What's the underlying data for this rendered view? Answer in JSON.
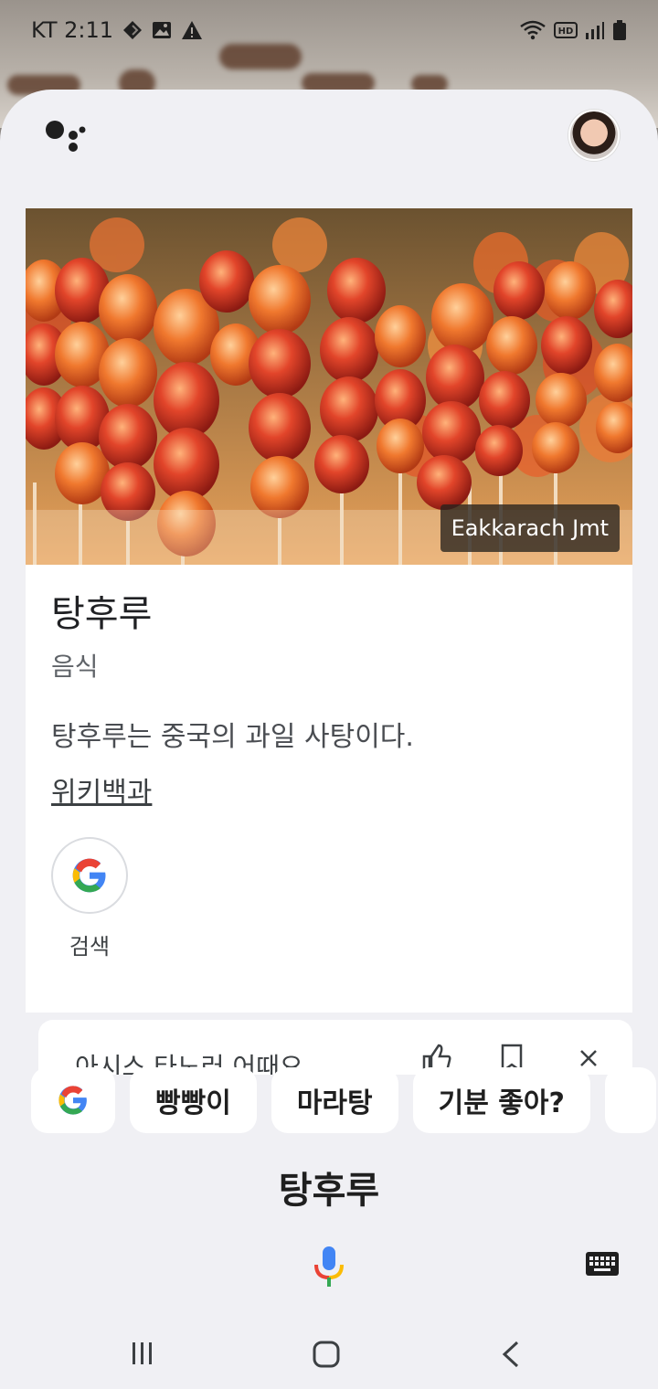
{
  "status_bar": {
    "carrier_time": "KT 2:11",
    "icons": [
      "diamond-icon",
      "image-icon",
      "warning-icon",
      "wifi-icon",
      "hd-icon",
      "signal-icon",
      "battery-icon"
    ]
  },
  "assistant": {
    "logo": "google-assistant-icon",
    "avatar": "user-avatar"
  },
  "card": {
    "image_credit": "Eakkarach Jmt",
    "title": "탕후루",
    "subtitle": "음식",
    "description": "탕후루는 중국의 과일 사탕이다.",
    "source_link": "위키백과",
    "search_label": "검색"
  },
  "peek_card": {
    "text": "아시스 타노러 어때요"
  },
  "suggestion_chips": [
    {
      "label": "",
      "icon": "google-g-icon"
    },
    {
      "label": "빵빵이"
    },
    {
      "label": "마라탕"
    },
    {
      "label": "기분 좋아?"
    },
    {
      "label": ""
    }
  ],
  "query": {
    "text": "탕후루"
  },
  "colors": {
    "sheet_bg": "#f0f0f4",
    "card_bg": "#ffffff",
    "text_primary": "#202124",
    "text_secondary": "#5f6368",
    "google_blue": "#4285F4",
    "google_red": "#EA4335",
    "google_yellow": "#FBBC05",
    "google_green": "#34A853"
  }
}
